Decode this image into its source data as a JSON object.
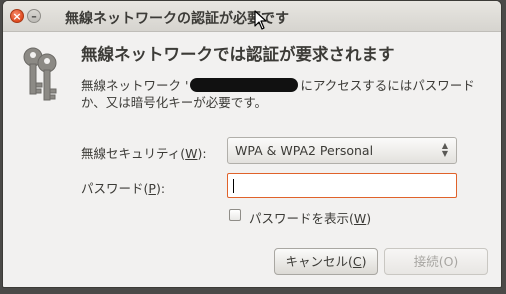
{
  "window": {
    "title": "無線ネットワークの認証が必要です"
  },
  "dialog": {
    "heading": "無線ネットワークでは認証が要求されます",
    "message_prefix": "無線ネットワーク '",
    "message_suffix": "にアクセスするにはパスワードか、又は暗号化キーが必要です。"
  },
  "form": {
    "security_label": "無線セキュリティ(",
    "security_mnemonic": "W",
    "security_value": "WPA & WPA2 Personal",
    "password_label": "パスワード(",
    "password_mnemonic": "P",
    "password_value": "",
    "show_password_label": "パスワードを表示(",
    "show_password_mnemonic": "W",
    "show_password_checked": false
  },
  "buttons": {
    "cancel_label": "キャンセル(",
    "cancel_mnemonic": "C",
    "connect_label": "接続(O)"
  },
  "icons": [
    "close-icon",
    "minimize-icon",
    "mouse-cursor-icon",
    "keys-icon",
    "spinner-arrows-icon"
  ]
}
